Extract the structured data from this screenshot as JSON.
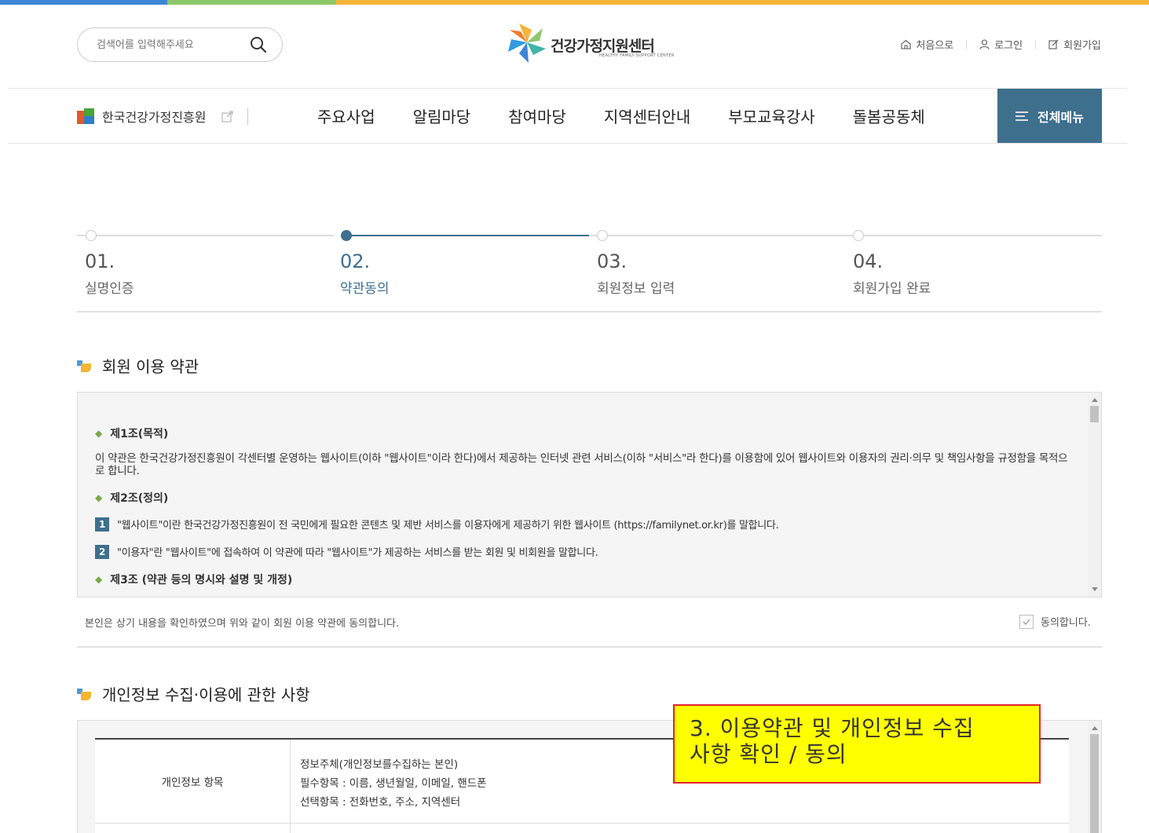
{
  "colors": {
    "topbar": [
      "#3c86d8",
      "#8cc86a",
      "#f5b43a"
    ],
    "accent": "#3e6f8d",
    "callout_bg": "#ffff00",
    "callout_border": "#e0242a"
  },
  "header": {
    "search_placeholder": "검색어를 입력해주세요",
    "logo_title": "건강가정지원센터",
    "logo_sub": "HEALTHY FAMILY SUPPORT CENTER",
    "util": {
      "home": "처음으로",
      "login": "로그인",
      "join": "회원가입"
    }
  },
  "nav": {
    "institute": "한국건강가정진흥원",
    "items": [
      "주요사업",
      "알림마당",
      "참여마당",
      "지역센터안내",
      "부모교육강사",
      "돌봄공동체"
    ],
    "all_menu": "전체메뉴"
  },
  "steps": [
    {
      "num": "01.",
      "label": "실명인증",
      "active": false
    },
    {
      "num": "02.",
      "label": "약관동의",
      "active": true
    },
    {
      "num": "03.",
      "label": "회원정보 입력",
      "active": false
    },
    {
      "num": "04.",
      "label": "회원가입 완료",
      "active": false
    }
  ],
  "terms": {
    "title": "회원 이용 약관",
    "art1_title": "제1조(목적)",
    "art1_text": "이 약관은 한국건강가정진흥원이 각센터별 운영하는 웹사이트(이하 \"웹사이트\"이라 한다)에서 제공하는 인터넷 관련 서비스(이하 \"서비스\"라 한다)를 이용함에 있어 웹사이트와 이용자의 권리·의무 및 책임사항을 규정함을 목적으로 합니다.",
    "art2_title": "제2조(정의)",
    "art2_items": [
      {
        "n": "1",
        "text": "\"웹사이트\"이란 한국건강가정진흥원이 전 국민에게 필요한 콘텐츠 및 제반 서비스를 이용자에게 제공하기 위한 웹사이트 (https://familynet.or.kr)를 말합니다."
      },
      {
        "n": "2",
        "text": "\"이용자\"란 \"웹사이트\"에 접속하여 이 약관에 따라 \"웹사이트\"가 제공하는 서비스를 받는 회원 및 비회원을 말합니다."
      }
    ],
    "art3_partial": "제3조 (약관 등의 명시와 설명 및 개정)",
    "agree_text": "본인은 상기 내용을 확인하였으며 위와 같이 회원 이용 약관에 동의합니다.",
    "agree_label": "동의합니다."
  },
  "privacy": {
    "title": "개인정보 수집·이용에 관한 사항",
    "row1_head": "개인정보 항목",
    "row1_lines": [
      "정보주체(개인정보를수집하는 본인)",
      "필수항목 : 이름, 생년월일, 이메일, 핸드폰",
      "선택항목 : 전화번호, 주소, 지역센터"
    ]
  },
  "callout": {
    "line1": "3. 이용약관 및 개인정보 수집",
    "line2": "사항 확인 / 동의"
  }
}
